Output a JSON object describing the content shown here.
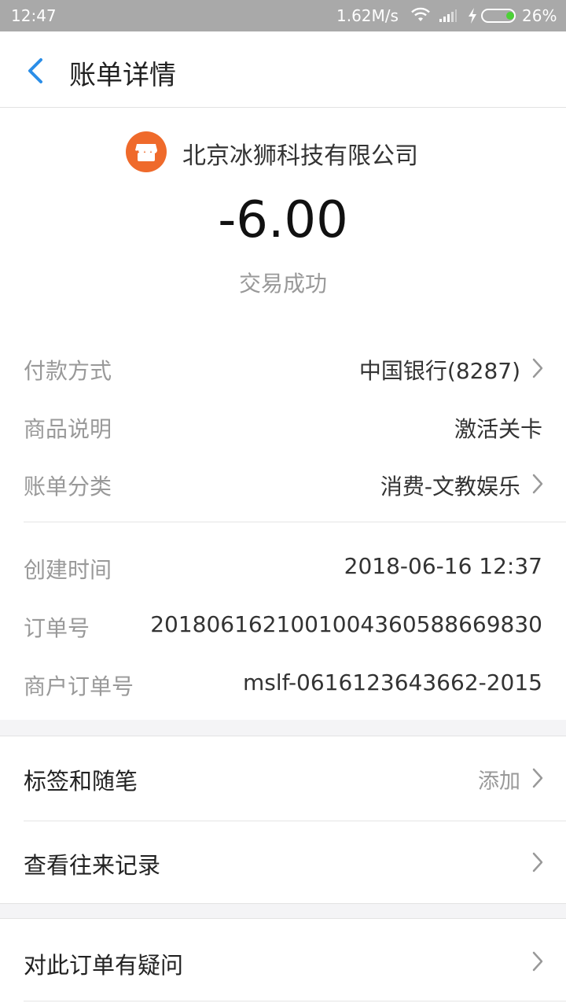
{
  "status_bar": {
    "time": "12:47",
    "network_speed": "1.62M/s",
    "battery": "26%",
    "icons": [
      "wifi-icon",
      "signal-icon",
      "charging-icon",
      "battery-icon"
    ]
  },
  "nav": {
    "title": "账单详情",
    "back_icon": "chevron-left-icon"
  },
  "bill": {
    "merchant_name": "北京冰狮科技有限公司",
    "merchant_icon": "store-icon",
    "amount": "-6.00",
    "status": "交易成功"
  },
  "details": [
    {
      "label": "付款方式",
      "value": "中国银行(8287)",
      "has_arrow": true
    },
    {
      "label": "商品说明",
      "value": "激活关卡",
      "has_arrow": false
    },
    {
      "label": "账单分类",
      "value": "消费-文教娱乐",
      "has_arrow": true
    }
  ],
  "order_info": [
    {
      "label": "创建时间",
      "value": "2018-06-16 12:37"
    },
    {
      "label": "订单号",
      "value": "2018061621001004360588669830"
    },
    {
      "label": "商户订单号",
      "value": "mslf-0616123643662-2015"
    }
  ],
  "actions": {
    "tags": {
      "label": "标签和随笔",
      "hint": "添加"
    },
    "history": {
      "label": "查看往来记录"
    },
    "question": {
      "label": "对此订单有疑问"
    }
  },
  "colors": {
    "accent": "#2b8ee8",
    "merchant_logo": "#ef6a2b",
    "status_bar": "#a9a9a9",
    "battery_fill": "#4cd137"
  }
}
